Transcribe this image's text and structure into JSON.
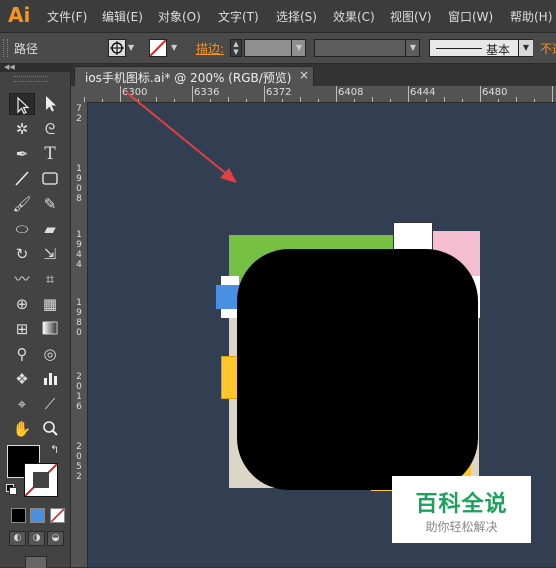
{
  "app": {
    "logo": "Ai"
  },
  "menu": {
    "items": [
      "文件(F)",
      "编辑(E)",
      "对象(O)",
      "文字(T)",
      "选择(S)",
      "效果(C)",
      "视图(V)",
      "窗口(W)",
      "帮助(H)"
    ]
  },
  "control_bar": {
    "object_type": "路径",
    "stroke_label": "描边:",
    "brush_label": "基本",
    "opacity_label": "不透"
  },
  "document": {
    "tab_title": "ios手机图标.ai* @ 200% (RGB/预览)",
    "close_glyph": "×"
  },
  "rulers": {
    "h_labels": [
      "6300",
      "6336",
      "6372",
      "6408",
      "6444",
      "6480"
    ],
    "v_labels": [
      "7",
      "2",
      "1",
      "9",
      "0",
      "8",
      "1",
      "9",
      "4",
      "4",
      "1",
      "9",
      "8",
      "0",
      "2",
      "0",
      "1",
      "6",
      "2",
      "0",
      "5",
      "2"
    ]
  },
  "colors": {
    "fill": "#000000",
    "canvas": "#323f52",
    "green_layer": "#76c043",
    "pink_layer": "#f4bed0",
    "blue_layer": "#4a90e2",
    "yellow_layer": "#ffc72c",
    "beige_layer": "#ddd5c5",
    "arrow": "#e04040"
  },
  "watermark": {
    "title": "百科全说",
    "subtitle": "助你轻松解决"
  }
}
